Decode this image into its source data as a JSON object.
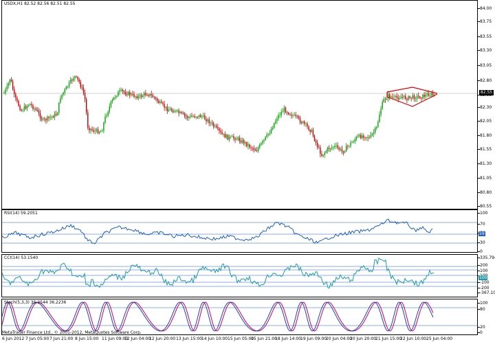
{
  "main": {
    "title": "USDX,H1  82.52 82.56 82.51 82.55",
    "scale": [
      "84.00",
      "83.75",
      "83.55",
      "83.30",
      "83.05",
      "82.80",
      "82.55",
      "82.30",
      "82.05",
      "81.80",
      "81.55",
      "81.30",
      "81.05",
      "80.80",
      "80.55"
    ],
    "current_price": "82.55",
    "colors": {
      "up": "#00a000",
      "down": "#c00000",
      "pattern": "#e00000",
      "level": "#c0c0c0"
    }
  },
  "rsi": {
    "title": "RSI(14) 59.2051",
    "scale": [
      "100",
      "70",
      "50",
      "30",
      "0"
    ],
    "marker": "59",
    "color": "#1f5fbf"
  },
  "cci": {
    "title": "CCI(14) 53.1540",
    "scale": [
      "335.794",
      "200",
      "100",
      "100",
      "-100",
      "-200",
      "-367.101"
    ],
    "marker": "100",
    "color": "#1f9aa8"
  },
  "stoch": {
    "title": "Stoch(5,3,3) 35.2544 36.2236",
    "scale": [
      "100",
      "80",
      "20",
      "0"
    ],
    "colors": {
      "main": "#1f3fbf",
      "signal": "#c0006a"
    }
  },
  "time_axis": [
    "6 Jun 2012",
    "7 Jun 05:00",
    "7 Jun 21:00",
    "8 Jun 15:00",
    "11 Jun 09:00",
    "12 Jun 04:00",
    "12 Jun 20:00",
    "13 Jun 15:00",
    "14 Jun 10:00",
    "15 Jun 05:00",
    "15 Jun 21:00",
    "18 Jun 14:00",
    "19 Jun 09:00",
    "20 Jun 04:00",
    "20 Jun 20:00",
    "21 Jun 15:00",
    "22 Jun 10:00",
    "25 Jun 04:00"
  ],
  "copyright": "MetaTrader Finance Ltd., © 2001-2012, MetaQuotes Software Corp."
}
